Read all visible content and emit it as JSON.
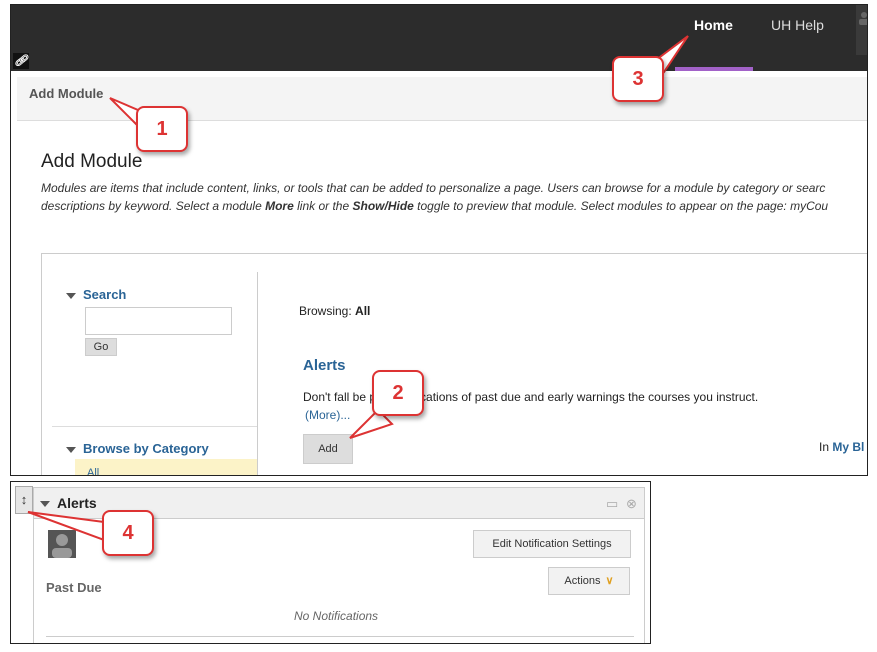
{
  "nav": {
    "home": "Home",
    "help": "UH Help",
    "link_icon": "link-icon",
    "user_icon": "user-icon"
  },
  "breadcrumb": "Add Module",
  "page": {
    "title": "Add Module",
    "desc_line1": "Modules are items that include content, links, or tools that can be added to personalize a page. Users can browse for a module by category or searc",
    "desc_line2_pre": "descriptions by keyword. Select a module ",
    "desc_line2_more": "More",
    "desc_line2_mid": " link or the ",
    "desc_line2_showhide": "Show/Hide",
    "desc_line2_post": " toggle to preview that module. Select modules to appear on the page: myCou"
  },
  "sidebar": {
    "search_title": "Search",
    "go_label": "Go",
    "category_title": "Browse by Category",
    "category_all": "All"
  },
  "browse": {
    "label": "Browsing:",
    "value": "All"
  },
  "module": {
    "title": "Alerts",
    "desc": "Don't fall be          play notifications of past due and early warnings the courses you instruct.",
    "more": "(More)...",
    "add_label": "Add",
    "in_label": "In",
    "in_value": "My Bl"
  },
  "callouts": [
    "1",
    "2",
    "3",
    "4"
  ],
  "alerts_panel": {
    "title": "Alerts",
    "edit_label": "Edit Notification Settings",
    "actions_label": "Actions",
    "past_due": "Past Due",
    "no_notifications": "No Notifications",
    "handle_glyph": "↕"
  },
  "colors": {
    "topbar": "#2c2c2c",
    "accent": "#a262c8",
    "link": "#2a6496",
    "callout": "#d33333"
  }
}
